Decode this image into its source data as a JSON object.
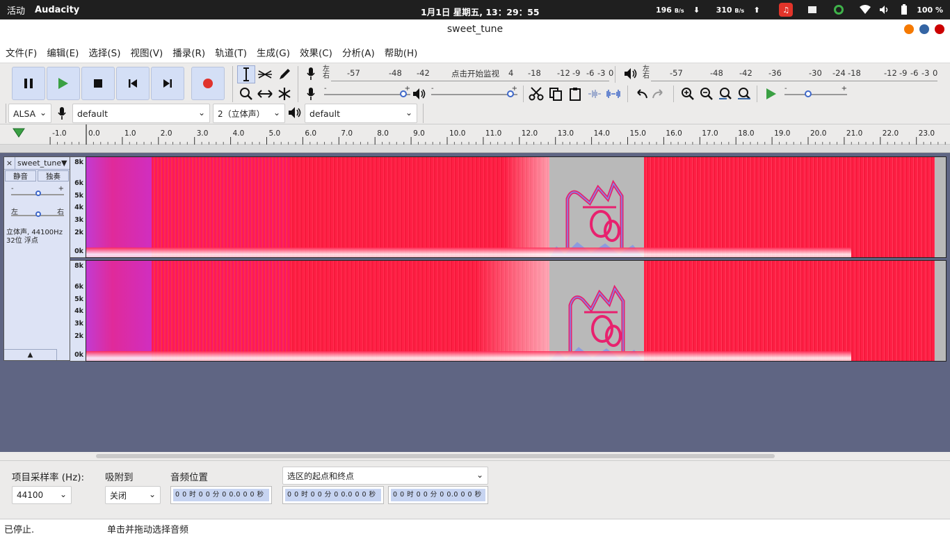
{
  "system_bar": {
    "activities": "活动",
    "app_name": "Audacity",
    "clock": "1月1日 星期五, 13：29：55",
    "down_rate": "196",
    "down_unit": "B/s",
    "up_rate": "310",
    "up_unit": "B/s",
    "battery": "100 %"
  },
  "window": {
    "title": "sweet_tune",
    "buttons": {
      "minimize_color": "#f57900",
      "maximize_color": "#3465a4",
      "close_color": "#cc0000"
    }
  },
  "menu": [
    "文件(F)",
    "编辑(E)",
    "选择(S)",
    "视图(V)",
    "播录(R)",
    "轨道(T)",
    "生成(G)",
    "效果(C)",
    "分析(A)",
    "帮助(H)"
  ],
  "toolbar": {
    "accent": "#d4dff6",
    "record_color": "#e0332d",
    "play_color": "#3aa043",
    "rec_meter": {
      "lr": "左右",
      "ticks": [
        "-57",
        "-48",
        "-42",
        "点击开始监视",
        "4",
        "-18",
        "-12",
        "-9",
        "-6",
        "-3",
        "0"
      ]
    },
    "play_meter": {
      "lr": "左右",
      "ticks": [
        "-57",
        "-48",
        "-42",
        "-36",
        "-30",
        "-24",
        "-18",
        "-12",
        "-9",
        "-6",
        "-3",
        "0"
      ]
    },
    "rec_volume_level": 0.95,
    "play_volume_level": 0.95,
    "speed_level": 0.33,
    "slider_minus": "-",
    "slider_plus": "+"
  },
  "devices": {
    "host": "ALSA",
    "recording_device": "default",
    "channels": "2（立体声）",
    "playback_device": "default"
  },
  "ruler": {
    "ticks": [
      "-1.0",
      "0.0",
      "1.0",
      "2.0",
      "3.0",
      "4.0",
      "5.0",
      "6.0",
      "7.0",
      "8.0",
      "9.0",
      "10.0",
      "11.0",
      "12.0",
      "13.0",
      "14.0",
      "15.0",
      "16.0",
      "17.0",
      "18.0",
      "19.0",
      "20.0",
      "21.0",
      "22.0",
      "23.0"
    ]
  },
  "track": {
    "name": "sweet_tune",
    "close": "×",
    "dropdown": "▼",
    "mute": "静音",
    "solo": "独奏",
    "gain_minus": "-",
    "gain_plus": "+",
    "pan_left": "左",
    "pan_right": "右",
    "gain_level": 0.5,
    "pan_level": 0.5,
    "info_line1": "立体声, 44100Hz",
    "info_line2": "32位 浮点",
    "collapse": "▲",
    "freq_labels": [
      "8k",
      "6k",
      "5k",
      "4k",
      "3k",
      "2k",
      "0k"
    ]
  },
  "selection_bar": {
    "rate_label": "项目采样率 (Hz):",
    "rate_value": "44100",
    "snap_label": "吸附到",
    "snap_value": "关闭",
    "position_label": "音频位置",
    "selection_mode": "选区的起点和终点",
    "time1": "0 0 时 0 0 分 0 0.0 0 0 秒",
    "time2": "0 0 时 0 0 分 0 0.0 0 0 秒",
    "time3": "0 0 时 0 0 分 0 0.0 0 0 秒"
  },
  "status": {
    "state": "已停止.",
    "hint": "单击并拖动选择音频"
  }
}
